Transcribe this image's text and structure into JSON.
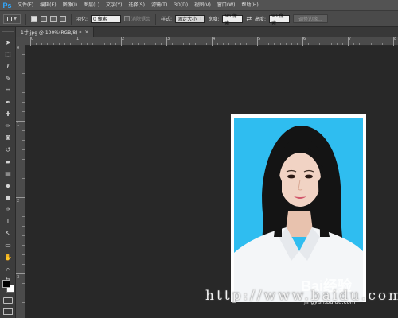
{
  "menubar": {
    "logo": "Ps",
    "items": [
      "文件(F)",
      "编辑(E)",
      "图像(I)",
      "图层(L)",
      "文字(Y)",
      "选择(S)",
      "滤镜(T)",
      "3D(D)",
      "视图(V)",
      "窗口(W)",
      "帮助(H)"
    ]
  },
  "options": {
    "feather_label": "羽化:",
    "feather_value": "0 像素",
    "antialias_label": "消除锯齿",
    "style_label": "样式:",
    "style_value": "固定大小",
    "width_label": "宽度:",
    "width_value": "90 像素",
    "height_label": "高度:",
    "height_value": "90 像素",
    "refine_edge_label": "调整边缘..."
  },
  "document": {
    "tab_title": "1寸.jpg @ 100%(RGB/8) *",
    "tab_close": "×"
  },
  "rulers": {
    "horizontal_labels": [
      "0",
      "1",
      "2",
      "3",
      "4",
      "5",
      "6",
      "7",
      "8"
    ],
    "vertical_labels": [
      "0",
      "1",
      "2",
      "3"
    ]
  },
  "watermark": {
    "text": "http://www.baidu.com",
    "logo": "Bai经验",
    "sub": "jingyan.baidu.com"
  },
  "colors": {
    "photo_background": "#2fbdf0",
    "accent": "#31a8ff"
  }
}
